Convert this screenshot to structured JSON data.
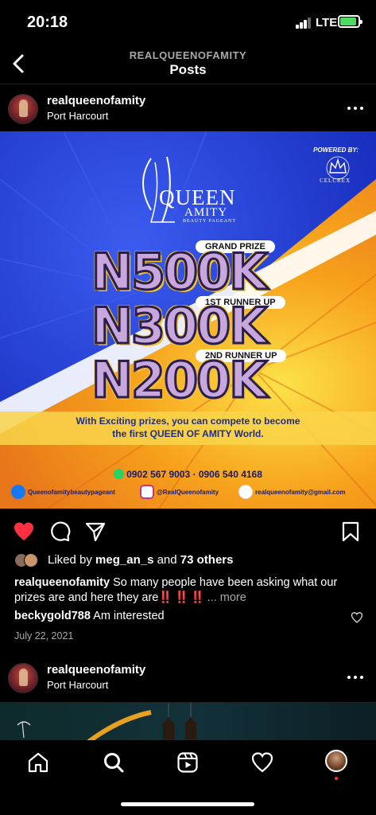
{
  "status": {
    "time": "20:18",
    "network": "LTE"
  },
  "header": {
    "subtitle": "REALQUEENOFAMITY",
    "title": "Posts"
  },
  "post1": {
    "username": "realqueenofamity",
    "location": "Port Harcourt",
    "poster": {
      "powered_by": "POWERED BY:",
      "sponsor": "CELCREX",
      "brand_queen": "QUEEN",
      "brand_amity": "AMITY",
      "brand_sub": "BEAUTY PAGEANT",
      "prizes": [
        {
          "label": "GRAND PRIZE",
          "amount": "N500K"
        },
        {
          "label": "1ST RUNNER UP",
          "amount": "N300K"
        },
        {
          "label": "2ND RUNNER UP",
          "amount": "N200K"
        }
      ],
      "tagline_line1": "With Exciting prizes, you can compete to become",
      "tagline_line2": "the first QUEEN OF AMITY World.",
      "phones": "0902 567 9003 · 0906 540 4168",
      "facebook": "Queenofamitybeautypageant",
      "instagram": "@RealQueenofamity",
      "email": "realqueenofamity@gmail.com"
    },
    "liked_by_prefix": "Liked by ",
    "liked_by_user": "meg_an_s",
    "liked_by_suffix": " and ",
    "liked_by_count": "73 others",
    "caption_user": "realqueenofamity",
    "caption_text": " So many people have been asking what our prizes are and here they are",
    "caption_bangs": "‼️ ‼️ ‼️",
    "caption_more_prefix": " ... ",
    "caption_more": "more",
    "comment_user": "beckygold788",
    "comment_text": " Am interested",
    "date": "July 22, 2021"
  },
  "post2": {
    "username": "realqueenofamity",
    "location": "Port Harcourt"
  },
  "colors": {
    "accent_like": "#ff3040",
    "poster_blue": "#1f3bd4",
    "poster_orange": "#f39a1e"
  }
}
